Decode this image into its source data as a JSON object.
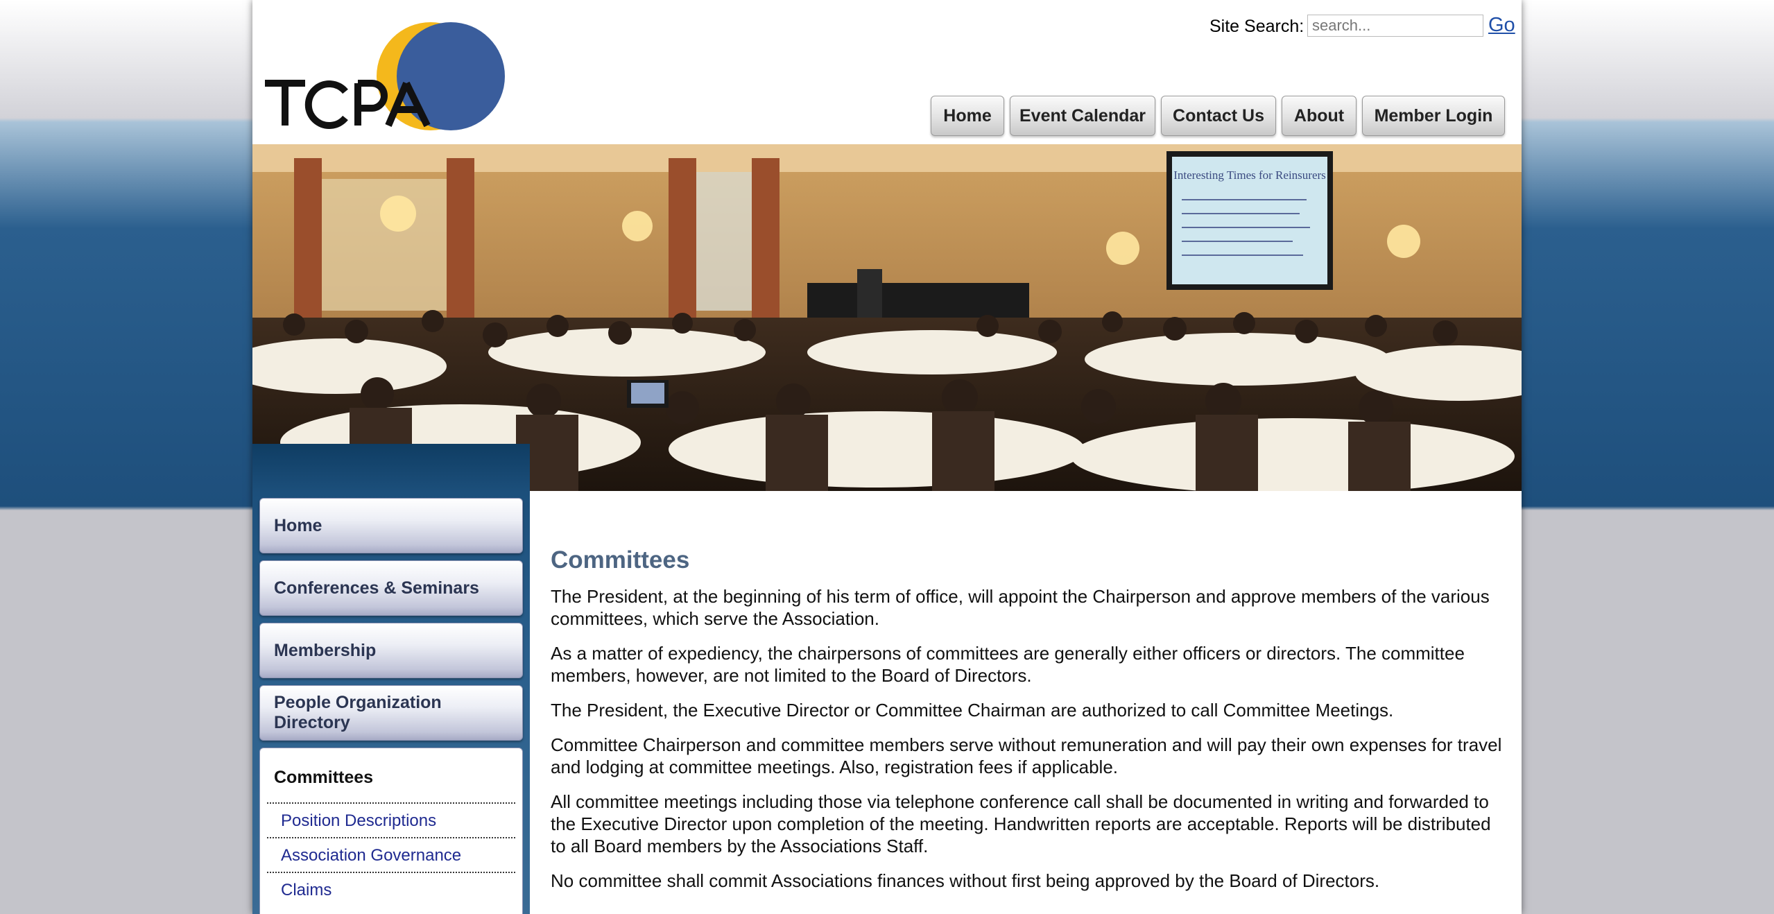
{
  "header": {
    "logo_text": "TCPA",
    "search_label": "Site Search:",
    "search_placeholder": "search...",
    "search_go": "Go"
  },
  "topnav": [
    "Home",
    "Event Calendar",
    "Contact Us",
    "About",
    "Member Login"
  ],
  "banner": {
    "slide_title": "Interesting Times for Reinsurers"
  },
  "sidebar": {
    "items": [
      "Home",
      "Conferences & Seminars",
      "Membership",
      "People Organization Directory"
    ],
    "active": "Committees",
    "subitems": [
      "Position Descriptions",
      "Association Governance",
      "Claims"
    ]
  },
  "content": {
    "title": "Committees",
    "paragraphs": [
      "The President, at the beginning of his term of office, will appoint the Chairperson and approve members of the various committees, which serve the Association.",
      "As a matter of expediency, the chairpersons of committees are generally either officers or directors. The committee members, however, are not limited to the Board of Directors.",
      "The President, the Executive Director or Committee Chairman are authorized to call Committee Meetings.",
      "Committee Chairperson and committee members serve without remuneration and will pay their own expenses for travel and lodging at committee meetings. Also, registration fees if applicable.",
      "All committee meetings including those via telephone conference call shall be documented in writing and forwarded to the Executive Director upon completion of the meeting. Handwritten reports are acceptable. Reports will be distributed to all Board members by the Associations Staff.",
      "No committee shall commit Associations finances without first being approved by the Board of Directors."
    ]
  },
  "colors": {
    "logo_blue": "#3a5d9c",
    "logo_gold": "#f4b81c",
    "heading": "#4d6582",
    "link": "#1f2a90"
  }
}
